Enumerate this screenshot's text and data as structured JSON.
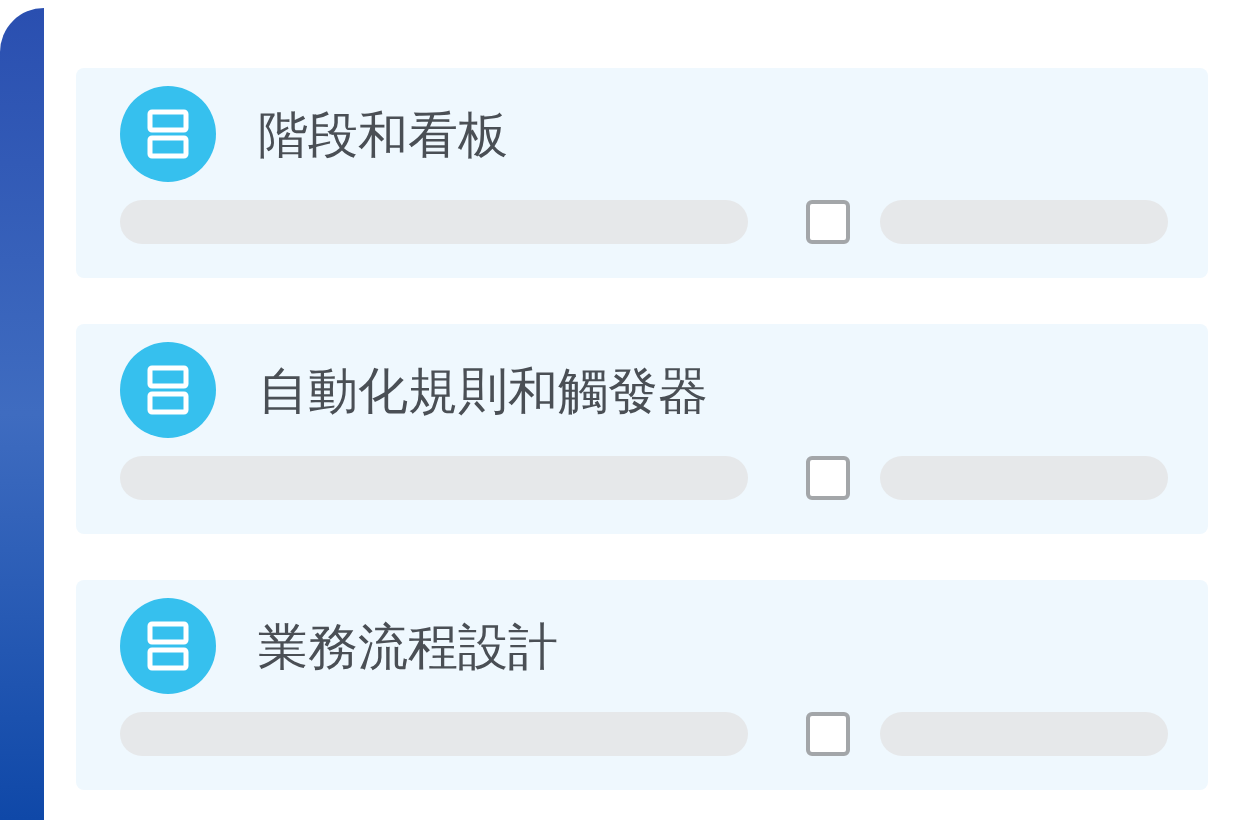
{
  "items": [
    {
      "title": "階段和看板",
      "checked": false
    },
    {
      "title": "自動化規則和觸發器",
      "checked": false
    },
    {
      "title": "業務流程設計",
      "checked": false
    }
  ]
}
